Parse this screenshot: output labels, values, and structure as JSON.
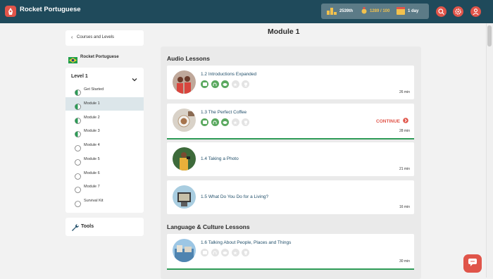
{
  "brand": {
    "name": "Rocket Portuguese"
  },
  "stats": {
    "rank": "2539th",
    "points": "1289 / 100",
    "streak": "1 day"
  },
  "colors": {
    "topbar": "#1f4a5b",
    "accent": "#e0554a",
    "progress": "#2e9b57",
    "icon_done": "#5aa85f"
  },
  "sidebar": {
    "back_label": "Courses and Levels",
    "course_name": "Rocket Portuguese",
    "level": "Level 1",
    "items": [
      {
        "label": "Get Started",
        "status": "half"
      },
      {
        "label": "Module 1",
        "status": "half"
      },
      {
        "label": "Module 2",
        "status": "half"
      },
      {
        "label": "Module 3",
        "status": "half"
      },
      {
        "label": "Module 4",
        "status": "empty"
      },
      {
        "label": "Module 5",
        "status": "empty"
      },
      {
        "label": "Module 6",
        "status": "empty"
      },
      {
        "label": "Module 7",
        "status": "empty"
      },
      {
        "label": "Survival Kit",
        "status": "empty"
      }
    ],
    "tools_label": "Tools"
  },
  "main": {
    "title": "Module 1",
    "sections": [
      {
        "heading": "Audio Lessons"
      },
      {
        "heading": "Language & Culture Lessons"
      }
    ],
    "lessons": [
      {
        "title": "1.2 Introductions Expanded",
        "duration": "26 min",
        "continue": "",
        "progress": 0
      },
      {
        "title": "1.3 The Perfect Coffee",
        "duration": "28 min",
        "continue": "CONTINUE",
        "progress": 1.0
      },
      {
        "title": "1.4 Taking a Photo",
        "duration": "21 min",
        "continue": "",
        "progress": 0
      },
      {
        "title": "1.5 What Do You Do for a Living?",
        "duration": "16 min",
        "continue": "",
        "progress": 0
      },
      {
        "title": "1.6 Talking About People, Places and Things",
        "duration": "30 min",
        "continue": "",
        "progress": 1.0
      }
    ]
  }
}
